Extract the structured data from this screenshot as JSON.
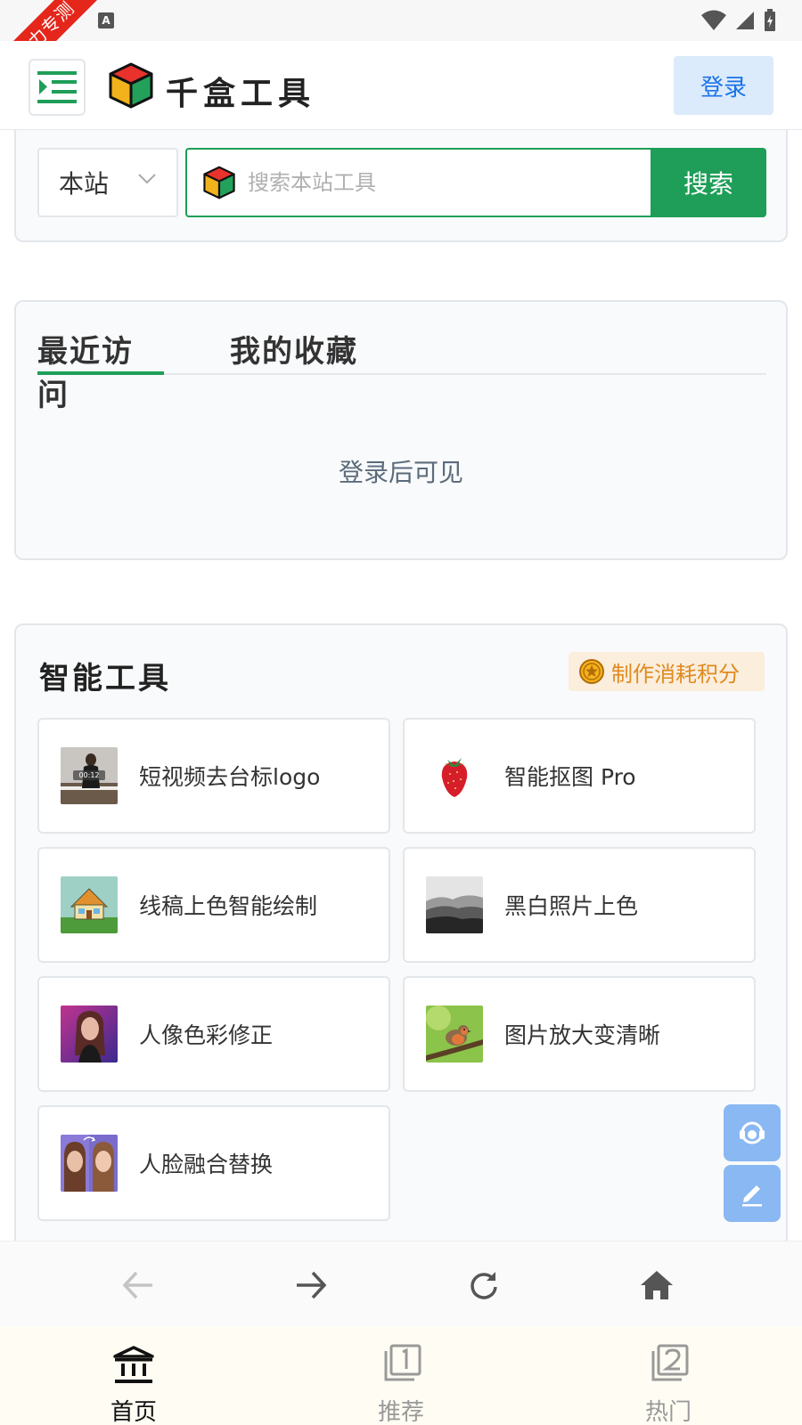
{
  "status_bar": {
    "ribbon_text": "圣力专测",
    "notification_icon": "A"
  },
  "header": {
    "menu_icon": "menu-indent-icon",
    "brand_name": "千盒工具",
    "login_label": "登录",
    "accent_color": "#1e9e58"
  },
  "search": {
    "scope_label": "本站",
    "placeholder": "搜索本站工具",
    "button_label": "搜索"
  },
  "recent": {
    "tabs": [
      {
        "label": "最近访问",
        "active": true
      },
      {
        "label": "我的收藏",
        "active": false
      }
    ],
    "empty_message": "登录后可见"
  },
  "tools": {
    "title": "智能工具",
    "points_badge": "制作消耗积分",
    "items": [
      {
        "label": "短视频去台标logo",
        "icon": "video-thumbnail",
        "thumb_text": "00:12"
      },
      {
        "label": "智能抠图 Pro",
        "icon": "strawberry-thumbnail"
      },
      {
        "label": "线稿上色智能绘制",
        "icon": "house-drawing-thumbnail"
      },
      {
        "label": "黑白照片上色",
        "icon": "bw-landscape-thumbnail"
      },
      {
        "label": "人像色彩修正",
        "icon": "portrait-thumbnail"
      },
      {
        "label": "图片放大变清晰",
        "icon": "bird-thumbnail"
      },
      {
        "label": "人脸融合替换",
        "icon": "face-swap-thumbnail"
      }
    ]
  },
  "floating_buttons": [
    {
      "icon": "customer-service-icon"
    },
    {
      "icon": "edit-icon"
    }
  ],
  "browser_nav": [
    {
      "icon": "back-arrow-icon"
    },
    {
      "icon": "forward-arrow-icon"
    },
    {
      "icon": "reload-icon"
    },
    {
      "icon": "home-icon"
    }
  ],
  "bottom_tabs": [
    {
      "label": "首页",
      "icon": "bank-icon",
      "active": true
    },
    {
      "label": "推荐",
      "icon": "number-1-icon",
      "active": false
    },
    {
      "label": "热门",
      "icon": "number-2-icon",
      "active": false
    }
  ]
}
